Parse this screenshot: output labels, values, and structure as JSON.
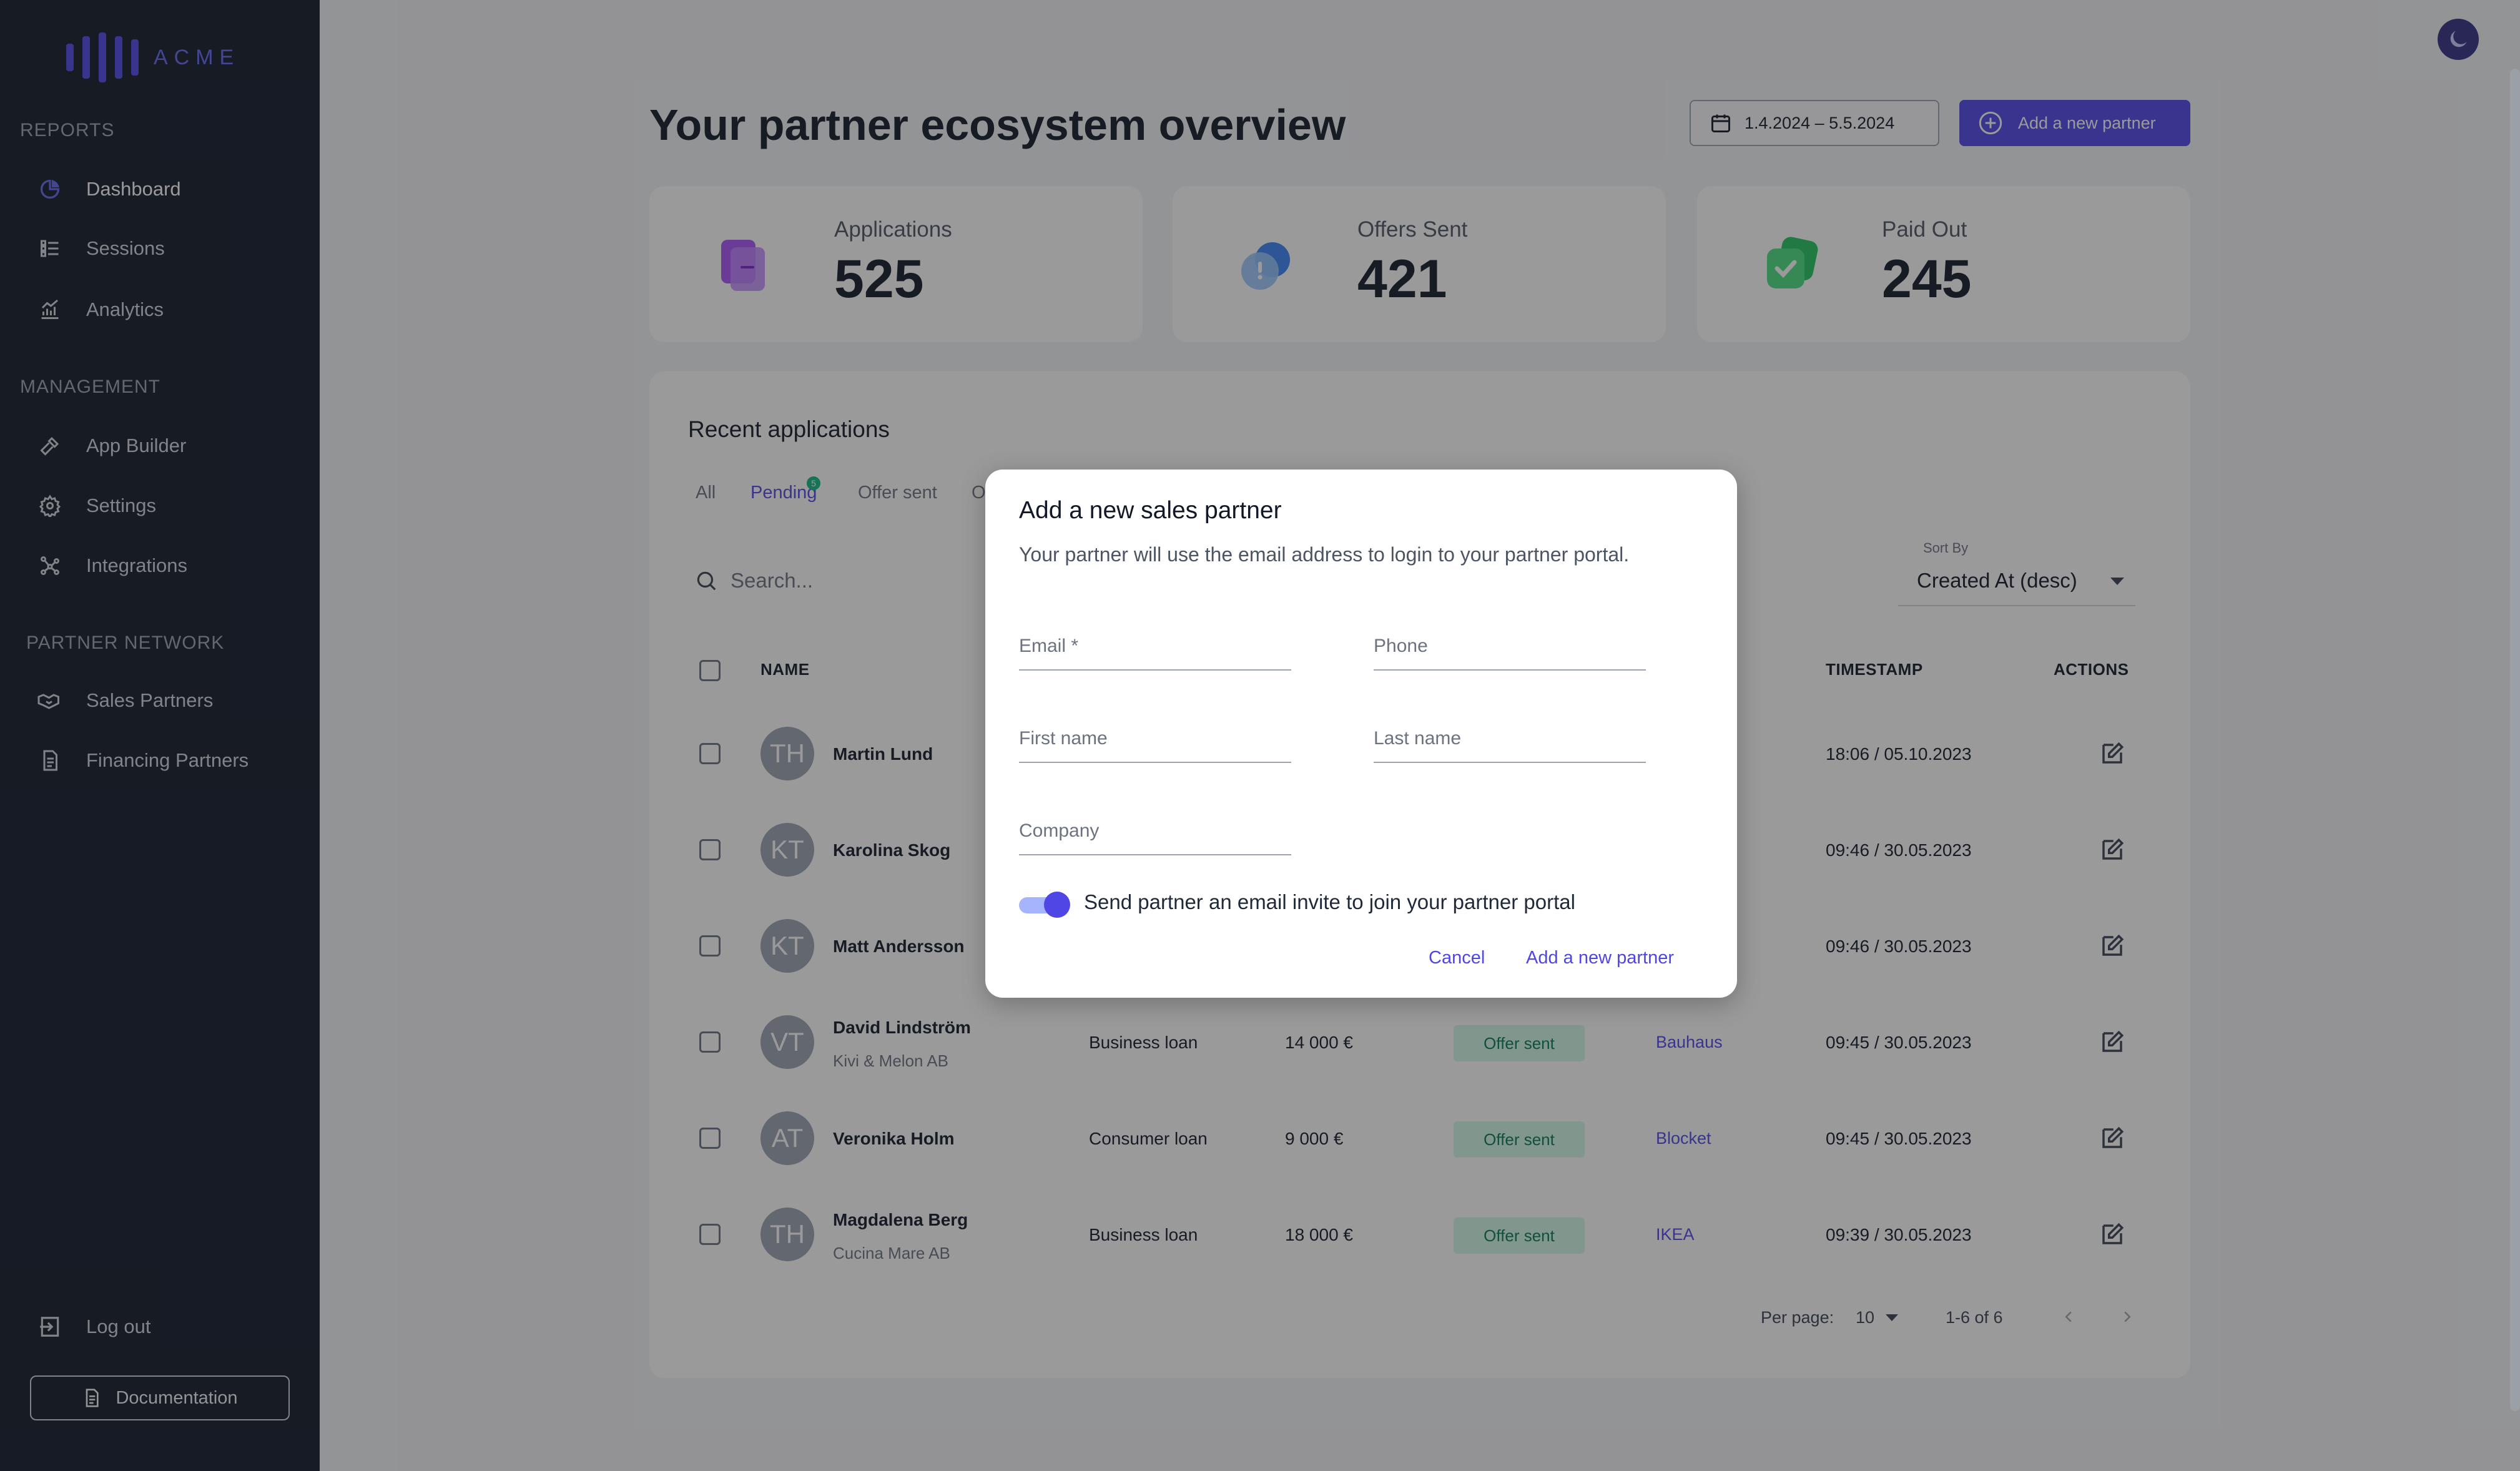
{
  "brand": {
    "logo_text": "ACME",
    "accent": "#4f46e5"
  },
  "sidebar": {
    "sections": [
      {
        "title": "REPORTS"
      },
      {
        "title": "MANAGEMENT"
      },
      {
        "title": "PARTNER NETWORK"
      }
    ],
    "items": [
      {
        "label": "Dashboard",
        "icon": "pie-chart-icon"
      },
      {
        "label": "Sessions",
        "icon": "list-icon"
      },
      {
        "label": "Analytics",
        "icon": "analytics-icon"
      },
      {
        "label": "App Builder",
        "icon": "hammer-icon"
      },
      {
        "label": "Settings",
        "icon": "gear-icon"
      },
      {
        "label": "Integrations",
        "icon": "integrations-icon"
      },
      {
        "label": "Sales Partners",
        "icon": "handshake-icon"
      },
      {
        "label": "Financing Partners",
        "icon": "document-icon"
      }
    ],
    "logout_label": "Log out",
    "documentation_label": "Documentation"
  },
  "header": {
    "title": "Your partner ecosystem overview",
    "date_range": "1.4.2024 – 5.5.2024",
    "add_partner_label": "Add a new partner"
  },
  "stats": [
    {
      "label": "Applications",
      "value": "525",
      "icon": "applications-icon"
    },
    {
      "label": "Offers Sent",
      "value": "421",
      "icon": "offers-icon"
    },
    {
      "label": "Paid Out",
      "value": "245",
      "icon": "paid-out-icon"
    }
  ],
  "recent": {
    "title": "Recent applications",
    "tabs": [
      {
        "label": "All"
      },
      {
        "label": "Pending",
        "badge": "5"
      },
      {
        "label": "Offer sent"
      },
      {
        "label": "O"
      }
    ],
    "search_placeholder": "Search...",
    "sort_label": "Sort By",
    "sort_value": "Created At (desc)",
    "columns": {
      "name": "NAME",
      "timestamp": "TIMESTAMP",
      "actions": "ACTIONS"
    },
    "rows": [
      {
        "initials": "TH",
        "name": "Martin Lund",
        "company": "",
        "type": "",
        "amount": "",
        "status": "",
        "partner": "",
        "timestamp": "18:06 / 05.10.2023"
      },
      {
        "initials": "KT",
        "name": "Karolina Skog",
        "company": "",
        "type": "",
        "amount": "",
        "status": "",
        "partner": "",
        "timestamp": "09:46 / 30.05.2023"
      },
      {
        "initials": "KT",
        "name": "Matt Andersson",
        "company": "",
        "type": "",
        "amount": "",
        "status": "",
        "partner": "",
        "timestamp": "09:46 / 30.05.2023"
      },
      {
        "initials": "VT",
        "name": "David Lindström",
        "company": "Kivi & Melon AB",
        "type": "Business loan",
        "amount": "14 000 €",
        "status": "Offer sent",
        "partner": "Bauhaus",
        "timestamp": "09:45 / 30.05.2023"
      },
      {
        "initials": "AT",
        "name": "Veronika Holm",
        "company": "",
        "type": "Consumer loan",
        "amount": "9 000 €",
        "status": "Offer sent",
        "partner": "Blocket",
        "timestamp": "09:45 / 30.05.2023"
      },
      {
        "initials": "TH",
        "name": "Magdalena Berg",
        "company": "Cucina Mare AB",
        "type": "Business loan",
        "amount": "18 000 €",
        "status": "Offer sent",
        "partner": "IKEA",
        "timestamp": "09:39 / 30.05.2023"
      }
    ],
    "pagination": {
      "per_page_label": "Per page:",
      "per_page_value": "10",
      "range": "1-6 of 6"
    }
  },
  "modal": {
    "title": "Add a new sales partner",
    "subtitle": "Your partner will use the email address to login to your partner portal.",
    "fields": {
      "email": "Email *",
      "phone": "Phone",
      "first_name": "First name",
      "last_name": "Last name",
      "company": "Company"
    },
    "toggle_label": "Send partner an email invite to join your partner portal",
    "toggle_on": true,
    "cancel_label": "Cancel",
    "submit_label": "Add a new partner"
  }
}
